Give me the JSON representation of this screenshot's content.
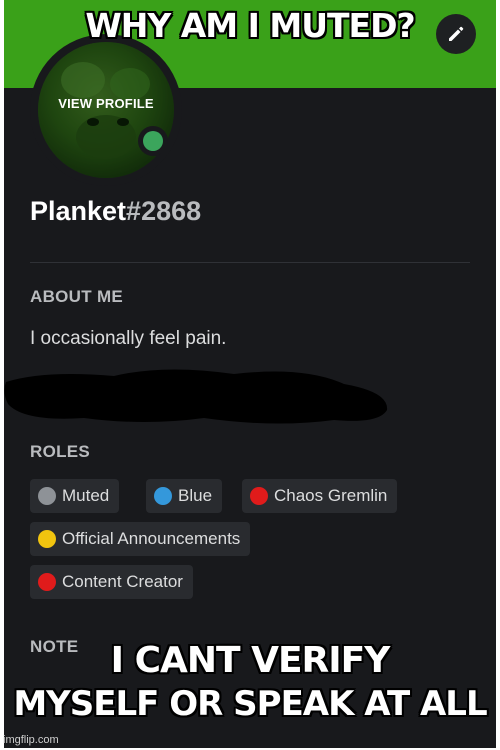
{
  "meme": {
    "top_text": "WHY AM I MUTED?",
    "bottom_text_line1": "I CANT VERIFY",
    "bottom_text_line2": "MYSELF OR SPEAK AT ALL",
    "watermark": "imgflip.com"
  },
  "profile": {
    "view_profile_label": "VIEW PROFILE",
    "username": "Planket",
    "discriminator": "#2868",
    "banner_color": "#3aa119",
    "status": "online",
    "status_color": "#3ba55c"
  },
  "about": {
    "heading": "ABOUT ME",
    "text": "I occasionally feel pain."
  },
  "roles": {
    "heading": "ROLES",
    "items": [
      {
        "label": "Muted",
        "color": "#8e9297"
      },
      {
        "label": "Blue",
        "color": "#3498db"
      },
      {
        "label": "Chaos Gremlin",
        "color": "#e01b1b"
      },
      {
        "label": "Official Announcements",
        "color": "#f1c40f"
      },
      {
        "label": "Content Creator",
        "color": "#e01b1b"
      }
    ]
  },
  "note": {
    "heading": "NOTE"
  },
  "icons": {
    "edit": "pencil-icon"
  }
}
